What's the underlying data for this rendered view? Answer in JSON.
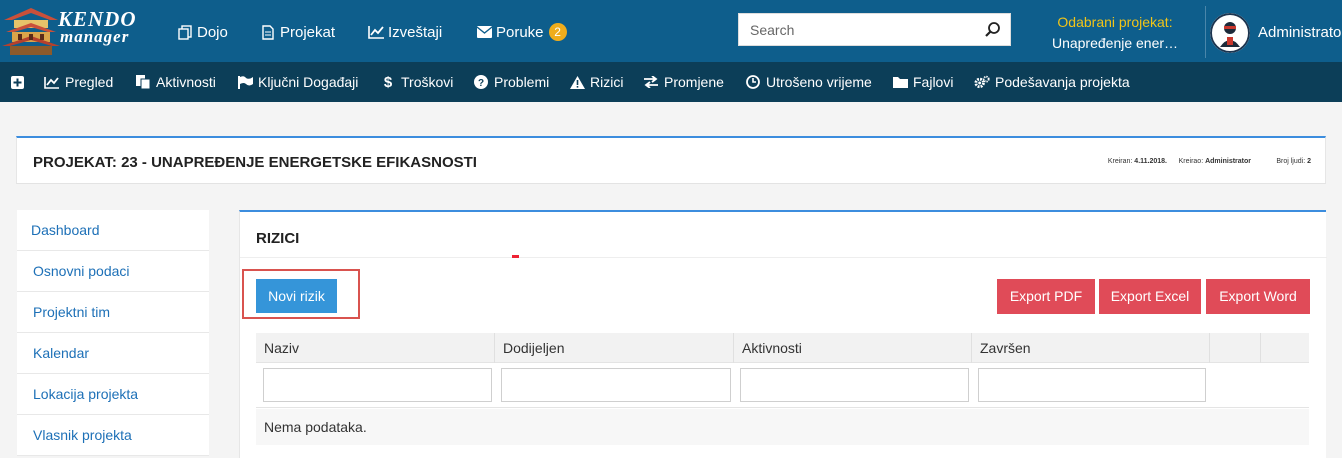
{
  "brand": {
    "line1": "KENDO",
    "line2": "manager"
  },
  "topnav": [
    {
      "label": "Dojo",
      "icon": "copy-icon"
    },
    {
      "label": "Projekat",
      "icon": "document-icon"
    },
    {
      "label": "Izveštaji",
      "icon": "line-chart-icon"
    },
    {
      "label": "Poruke",
      "icon": "envelope-icon",
      "badge": "2"
    }
  ],
  "search": {
    "placeholder": "Search",
    "value": ""
  },
  "selected_project": {
    "label": "Odabrani projekat:",
    "value": "Unapređenje ener…"
  },
  "user": {
    "name": "Administrator"
  },
  "subnav": [
    {
      "label": "",
      "icon": "plus-square-icon"
    },
    {
      "label": "Pregled",
      "icon": "line-chart-icon"
    },
    {
      "label": "Aktivnosti",
      "icon": "tasks-icon"
    },
    {
      "label": "Ključni Događaji",
      "icon": "flag-icon"
    },
    {
      "label": "Troškovi",
      "icon": "dollar-icon"
    },
    {
      "label": "Problemi",
      "icon": "question-circle-icon"
    },
    {
      "label": "Rizici",
      "icon": "warning-icon"
    },
    {
      "label": "Promjene",
      "icon": "exchange-icon"
    },
    {
      "label": "Utrošeno vrijeme",
      "icon": "clock-icon"
    },
    {
      "label": "Fajlovi",
      "icon": "folder-icon"
    },
    {
      "label": "Podešavanja projekta",
      "icon": "gears-icon"
    }
  ],
  "project": {
    "title": "PROJEKAT: 23 - UNAPREĐENJE ENERGETSKE EFIKASNOSTI",
    "created_label": "Kreiran:",
    "created_value": "4.11.2018.",
    "creator_label": "Kreirao:",
    "creator_value": "Administrator",
    "people_label": "Broj ljudi:",
    "people_value": "2"
  },
  "sidebar": {
    "items": [
      {
        "label": "Dashboard"
      },
      {
        "label": "Osnovni podaci"
      },
      {
        "label": "Projektni tim"
      },
      {
        "label": "Kalendar"
      },
      {
        "label": "Lokacija projekta"
      },
      {
        "label": "Vlasnik projekta"
      }
    ]
  },
  "main": {
    "title": "RIZICI",
    "new_button": "Novi rizik",
    "export": {
      "pdf": "Export PDF",
      "excel": "Export Excel",
      "word": "Export Word"
    },
    "grid": {
      "columns": [
        "Naziv",
        "Dodijeljen",
        "Aktivnosti",
        "Završen"
      ],
      "empty_text": "Nema podataka."
    }
  },
  "colors": {
    "topbar": "#0e5e8c",
    "subbar": "#0c3e58",
    "accent": "#3c8dde",
    "new_button": "#3595d9",
    "export_button": "#e04b58",
    "badge": "#f0ad1c",
    "selected_label": "#f0c419",
    "highlight": "#d9534f"
  }
}
